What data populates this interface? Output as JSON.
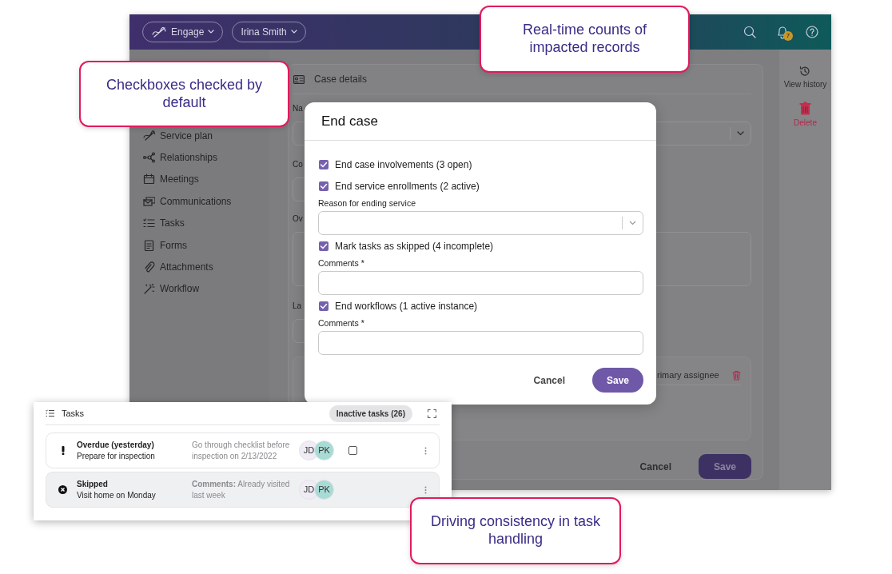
{
  "app": {
    "header": {
      "app_switcher": "Engage",
      "user_menu": "Irina Smith",
      "notification_count": "7"
    },
    "sidebar": {
      "items": [
        {
          "label": "Service plan"
        },
        {
          "label": "Relationships"
        },
        {
          "label": "Meetings"
        },
        {
          "label": "Communications"
        },
        {
          "label": "Tasks"
        },
        {
          "label": "Forms"
        },
        {
          "label": "Attachments"
        },
        {
          "label": "Workflow"
        }
      ]
    },
    "case_details": {
      "title": "Case details",
      "field_labels": [
        "Na",
        "Co",
        "Ov",
        "La"
      ],
      "assignee_label": "rimary assignee",
      "cancel_button": "Cancel",
      "save_button": "Save"
    },
    "right_rail": [
      {
        "label": "View history",
        "kind": "history"
      },
      {
        "label": "Delete",
        "kind": "delete"
      }
    ]
  },
  "modal": {
    "title": "End case",
    "options": [
      {
        "label": "End case involvements (3 open)",
        "checked": true
      },
      {
        "label": "End service enrollments (2 active)",
        "checked": true,
        "field": {
          "label": "Reason for ending service",
          "kind": "select"
        }
      },
      {
        "label": "Mark tasks as skipped (4 incomplete)",
        "checked": true,
        "field": {
          "label": "Comments *",
          "kind": "text"
        }
      },
      {
        "label": "End workflows (1 active instance)",
        "checked": true,
        "field": {
          "label": "Comments *",
          "kind": "text"
        }
      }
    ],
    "cancel_button": "Cancel",
    "save_button": "Save"
  },
  "tasks_panel": {
    "title": "Tasks",
    "inactive_button": "Inactive tasks (26)",
    "rows": [
      {
        "kind": "overdue",
        "title": "Overdue (yesterday)",
        "name": "Prepare for inspection",
        "note": "Go through checklist before inspection on 2/13/2022",
        "checked": false,
        "assignees": [
          {
            "initials": "JD",
            "color": "#efecf5"
          },
          {
            "initials": "PK",
            "color": "#a9dbd5"
          }
        ]
      },
      {
        "kind": "skipped",
        "title": "Skipped",
        "name": "Visit home on Monday",
        "note": "**Comments:** Already visited last week",
        "assignees": [
          {
            "initials": "JD",
            "color": "#efecf5"
          },
          {
            "initials": "PK",
            "color": "#a9dbd5"
          }
        ]
      }
    ]
  },
  "callouts": [
    {
      "text": "Checkboxes checked by default"
    },
    {
      "text": "Real-time counts of impacted records"
    },
    {
      "text": "Driving consistency in task handling"
    }
  ]
}
